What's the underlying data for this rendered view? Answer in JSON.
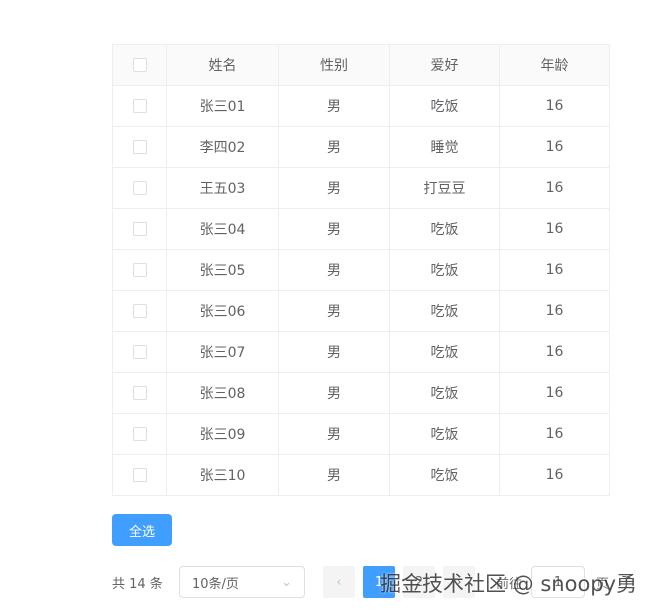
{
  "table": {
    "headers": [
      "姓名",
      "性别",
      "爱好",
      "年龄"
    ],
    "rows": [
      [
        "张三01",
        "男",
        "吃饭",
        "16"
      ],
      [
        "李四02",
        "男",
        "睡觉",
        "16"
      ],
      [
        "王五03",
        "男",
        "打豆豆",
        "16"
      ],
      [
        "张三04",
        "男",
        "吃饭",
        "16"
      ],
      [
        "张三05",
        "男",
        "吃饭",
        "16"
      ],
      [
        "张三06",
        "男",
        "吃饭",
        "16"
      ],
      [
        "张三07",
        "男",
        "吃饭",
        "16"
      ],
      [
        "张三08",
        "男",
        "吃饭",
        "16"
      ],
      [
        "张三09",
        "男",
        "吃饭",
        "16"
      ],
      [
        "张三10",
        "男",
        "吃饭",
        "16"
      ]
    ]
  },
  "select_all": "全选",
  "pagination": {
    "total": "共 14 条",
    "page_size": "10条/页",
    "prev": "‹",
    "pages": [
      "1",
      "2"
    ],
    "next": "›",
    "goto": "前往",
    "goto_value": "1",
    "page_unit": "页"
  },
  "watermark": "掘金技术社区 @ snoopy勇"
}
